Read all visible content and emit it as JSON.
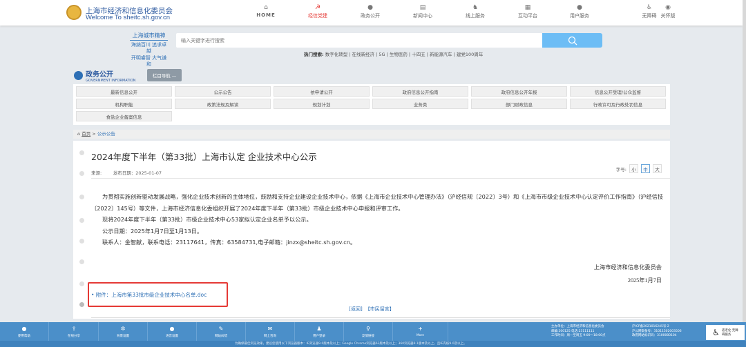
{
  "header": {
    "site_name_cn": "上海市经济和信息化委员会",
    "site_name_en": "Welcome To sheitc.sh.gov.cn",
    "nav": [
      {
        "label": "HOME",
        "icon": "home-icon"
      },
      {
        "label": "经信党建",
        "icon": "party-icon"
      },
      {
        "label": "政务公开",
        "icon": "chat-icon"
      },
      {
        "label": "新闻中心",
        "icon": "news-icon"
      },
      {
        "label": "线上服务",
        "icon": "service-icon"
      },
      {
        "label": "互动平台",
        "icon": "interact-icon"
      },
      {
        "label": "用户服务",
        "icon": "user-icon"
      }
    ],
    "accessibility": "无障碍",
    "care_mode": "关怀版",
    "active_color": "#e53935"
  },
  "spirit": {
    "title": "上海城市精神",
    "line1": "海纳百川 追求卓越",
    "line2": "开明睿智 大气谦和"
  },
  "search": {
    "placeholder": "输入关键字进行搜索",
    "hot_label": "热门搜索:",
    "hot": [
      "数字化转型",
      "在线新经济",
      "5G",
      "生物医药",
      "十四五",
      "新能源汽车",
      "建党100周年"
    ]
  },
  "section": {
    "title": "政务公开",
    "subtitle": "GOVERNMENT INFORMATION",
    "column_nav": "栏目导航 —"
  },
  "categories": [
    "最新信息公开",
    "公示公告",
    "依申请公开",
    "政府信息公开指南",
    "政府信息公开年报",
    "信息公开受理/公众监督",
    "机构职能",
    "政策法规及解读",
    "规划计划",
    "业务类",
    "部门财政信息",
    "行政许可及行政处罚信息",
    "食盐企业备案信息"
  ],
  "breadcrumb": {
    "home": "首页",
    "sep": ">",
    "current": "公示公告"
  },
  "article": {
    "title": "2024年度下半年（第33批）上海市认定 企业技术中心公示",
    "source_label": "来源:",
    "date_label": "发布日期：2025-01-07",
    "font_size_label": "字号:",
    "font_sizes": [
      "小",
      "中",
      "大"
    ],
    "paragraphs": [
      "为贯彻实施创新驱动发展战略，强化企业技术创新的主体地位，鼓励和支持企业建设企业技术中心，依据《上海市企业技术中心管理办法》（沪经信规〔2022〕3号）和《上海市市级企业技术中心认定评价工作指南》（沪经信技〔2022〕145号）等文件，上海市经济信息化委组织开展了2024年度下半年（第33批）市级企业技术中心申报和评审工作。",
      "现将2024年度下半年（第33批）市级企业技术中心53家拟认定企业名单予以公示。",
      "公示日期：2025年1月7日至1月13日。",
      "联系人：金智献，联系电话：23117641，传真：63584731,电子邮箱：jinzx@sheitc.sh.gov.cn。"
    ],
    "signature": "上海市经济和信息化委员会",
    "sign_date": "2025年1月7日",
    "attachment": "• 附件：上海市第33批市级企业技术中心名单.doc",
    "back": "[返回]",
    "message": "【市民留言】"
  },
  "footer": {
    "items": [
      {
        "label": "使用帮助",
        "icon": "info-icon"
      },
      {
        "label": "在线分享",
        "icon": "share-icon"
      },
      {
        "label": "背景设置",
        "icon": "gear-icon"
      },
      {
        "label": "语音设置",
        "icon": "voice-icon"
      },
      {
        "label": "网站纠错",
        "icon": "wrench-icon"
      },
      {
        "label": "网上咨询",
        "icon": "consult-icon"
      },
      {
        "label": "用户登录",
        "icon": "user-icon"
      },
      {
        "label": "友情链接",
        "icon": "link-icon"
      },
      {
        "label": "More",
        "icon": "plus-icon"
      }
    ],
    "host": "主办单位：上海市经济和信息化委员会",
    "postal": "邮编:200125 电话:23111111",
    "hours": "工作时间：周一至周五 9:00～18:00点",
    "icp": "沪ICP备2021016245号-2",
    "police": "沪公网安备号：31011502003506",
    "site_code": "政府网站标识码：3100000104",
    "a11y": "适老化 无障碍服务",
    "notice": "为确保最佳浏览效果，建议您使用以下浏览器版本：IE浏览器9.0版本及以上；Google Chrome浏览器63版本及以上；360浏览器9.1版本及以上，且IE内核9.0及以上。"
  }
}
